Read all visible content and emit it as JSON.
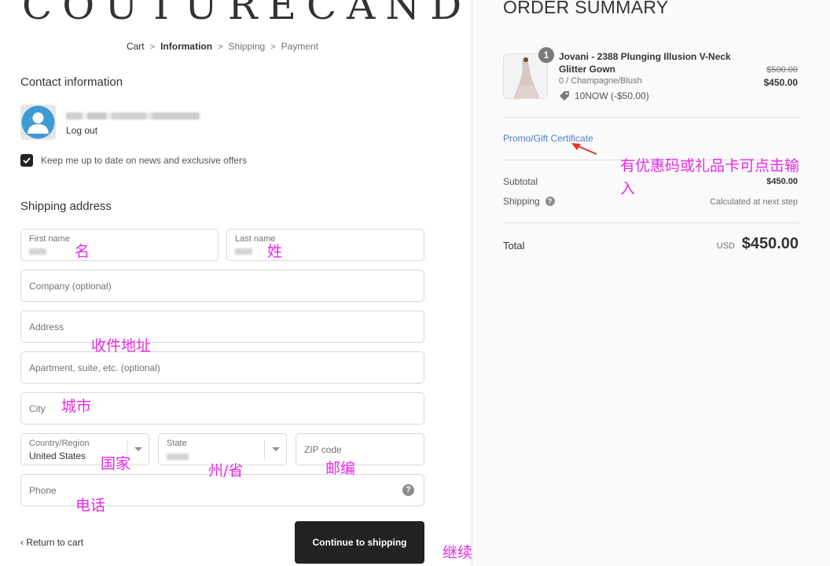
{
  "brand": {
    "logo_text": "COUTURECANDY"
  },
  "breadcrumb": {
    "items": [
      {
        "label": "Cart",
        "state": "link"
      },
      {
        "label": "Information",
        "state": "current"
      },
      {
        "label": "Shipping",
        "state": "upcoming"
      },
      {
        "label": "Payment",
        "state": "upcoming"
      }
    ],
    "separator": ">"
  },
  "contact": {
    "title": "Contact information",
    "logout_label": "Log out",
    "newsletter_label": "Keep me up to date on news and exclusive offers",
    "newsletter_checked": true
  },
  "shipping": {
    "title": "Shipping address",
    "fields": {
      "first_name": {
        "label": "First name"
      },
      "last_name": {
        "label": "Last name"
      },
      "company": {
        "placeholder": "Company (optional)"
      },
      "address": {
        "placeholder": "Address"
      },
      "apartment": {
        "placeholder": "Apartment, suite, etc. (optional)"
      },
      "city": {
        "placeholder": "City"
      },
      "country": {
        "label": "Country/Region",
        "value": "United States"
      },
      "state": {
        "label": "State"
      },
      "zip": {
        "placeholder": "ZIP code"
      },
      "phone": {
        "placeholder": "Phone"
      }
    }
  },
  "actions": {
    "return_label": "Return to cart",
    "continue_label": "Continue to shipping"
  },
  "annotations": {
    "first_name": "名",
    "last_name": "姓",
    "address": "收件地址",
    "city": "城市",
    "country": "国家",
    "state": "州/省",
    "zip": "邮编",
    "phone": "电话",
    "continue": "继续",
    "promo_line1": "有优惠码或礼品卡可点击输",
    "promo_line2": "入"
  },
  "summary": {
    "title": "ORDER SUMMARY",
    "product": {
      "quantity": "1",
      "name": "Jovani - 2388 Plunging Illusion V-Neck Glitter Gown",
      "variant": "0 / Champagne/Blush",
      "discount": "10NOW (-$50.00)",
      "price_original": "$500.00",
      "price_final": "$450.00"
    },
    "promo_link": "Promo/Gift Certificate",
    "subtotal_label": "Subtotal",
    "subtotal_value": "$450.00",
    "shipping_label": "Shipping",
    "shipping_value": "Calculated at next step",
    "total_label": "Total",
    "total_currency": "USD",
    "total_value": "$450.00"
  },
  "colors": {
    "annotation": "#e82ae8",
    "link": "#4a82c9",
    "button": "#222222",
    "arrow": "#e8332a"
  }
}
